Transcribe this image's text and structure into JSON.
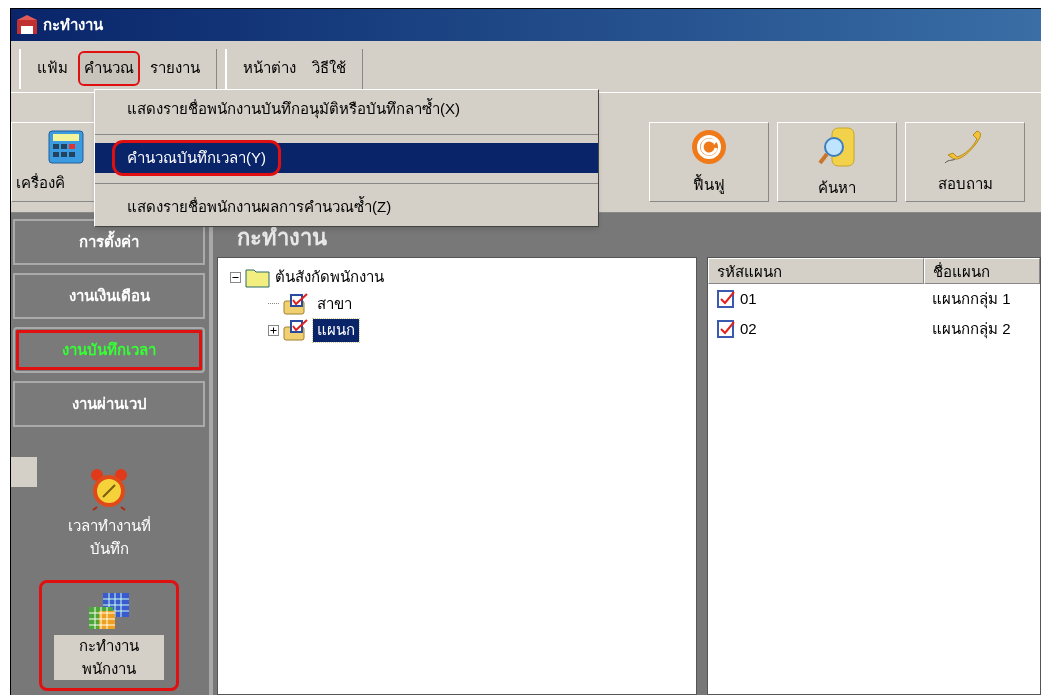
{
  "window": {
    "title": "กะทำงาน"
  },
  "menubar": [
    [
      {
        "label": "แฟ้ม",
        "selected": false
      },
      {
        "label": "คำนวณ",
        "selected": true
      },
      {
        "label": "รายงาน",
        "selected": false
      }
    ],
    [
      {
        "label": "หน้าต่าง",
        "selected": false
      },
      {
        "label": "วิธีใช้",
        "selected": false
      }
    ]
  ],
  "dropdown": [
    {
      "label": "แสดงรายชื่อพนักงานบันทึกอนุมัติหรือบันทึกลาซ้ำ(X)",
      "selected": false
    },
    {
      "label": "คำนวณบันทึกเวลา(Y)",
      "selected": true
    },
    {
      "label": "แสดงรายชื่อพนักงานผลการคำนวณซ้ำ(Z)",
      "selected": false
    }
  ],
  "toolbar": [
    {
      "label": "เครื่องคิ",
      "kind": "calculator"
    },
    {
      "label": "ฟื้นฟู",
      "kind": "refresh"
    },
    {
      "label": "ค้นหา",
      "kind": "search"
    },
    {
      "label": "สอบถาม",
      "kind": "phone"
    }
  ],
  "sidebar": {
    "sections": [
      {
        "label": "การตั้งค่า",
        "selected": false
      },
      {
        "label": "งานเงินเดือน",
        "selected": false
      },
      {
        "label": "งานบันทึกเวลา",
        "selected": true
      },
      {
        "label": "งานผ่านเวป",
        "selected": false
      }
    ],
    "items": [
      {
        "label": "เวลาทำงานที่บันทึก",
        "kind": "alarm",
        "selected": false
      },
      {
        "label": "กะทำงานพนักงาน",
        "kind": "grid",
        "selected": true
      }
    ]
  },
  "panel_title": "กะทำงาน",
  "tree": {
    "label": "ต้นสังกัดพนักงาน",
    "expanded": true,
    "children": [
      {
        "label": "สาขา",
        "selected": false
      },
      {
        "label": "แผนก",
        "selected": true,
        "expanded": false
      }
    ]
  },
  "table": {
    "columns": [
      "รหัสแผนก",
      "ชื่อแผนก"
    ],
    "rows": [
      [
        "01",
        "แผนกกลุ่ม 1"
      ],
      [
        "02",
        "แผนกกลุ่ม 2"
      ]
    ]
  }
}
